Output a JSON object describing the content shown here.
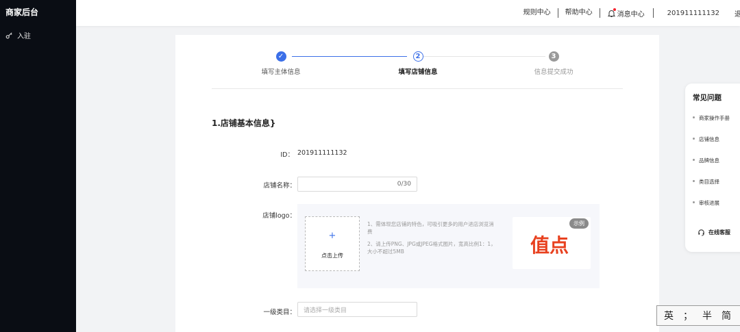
{
  "sidebar": {
    "brand": "商家后台",
    "items": [
      {
        "label": "入驻",
        "icon": "key-icon"
      }
    ]
  },
  "header": {
    "rules": "规则中心",
    "help": "帮助中心",
    "messages": "消息中心",
    "account": "201911111132",
    "more": "退"
  },
  "steps": [
    {
      "num": "✓",
      "label": "填写主体信息",
      "state": "done"
    },
    {
      "num": "2",
      "label": "填写店铺信息",
      "state": "active"
    },
    {
      "num": "3",
      "label": "信息提交成功",
      "state": "pending"
    }
  ],
  "section": {
    "title": "1.店铺基本信息}"
  },
  "form": {
    "id_label": "ID：",
    "id_value": "201911111132",
    "name_label": "店铺名称：",
    "name_counter": "0/30",
    "logo_label": "店铺logo：",
    "upload_plus": "+",
    "upload_text": "点击上传",
    "tip1": "1、需体现您店铺的特色，可吸引更多的用户进店浏览消费",
    "tip2": "2、请上传PNG、JPG或JPEG格式图片，宽高比例1：1，大小不超过5MB",
    "example_tag": "示例",
    "example_logo": "值点",
    "category_label": "一级类目：",
    "category_placeholder": "请选择一级类目"
  },
  "faq": {
    "title": "常见问题",
    "items": [
      "商家操作手册",
      "店铺信息",
      "品牌信息",
      "类目选择",
      "审核进展"
    ],
    "service": "在线客服"
  },
  "ime": {
    "items": [
      "英",
      "；",
      "半",
      "简",
      "👕"
    ]
  },
  "colors": {
    "primary": "#3b6fe8",
    "sidebar_bg": "#0a0d14",
    "brand_red": "#e8411f"
  }
}
